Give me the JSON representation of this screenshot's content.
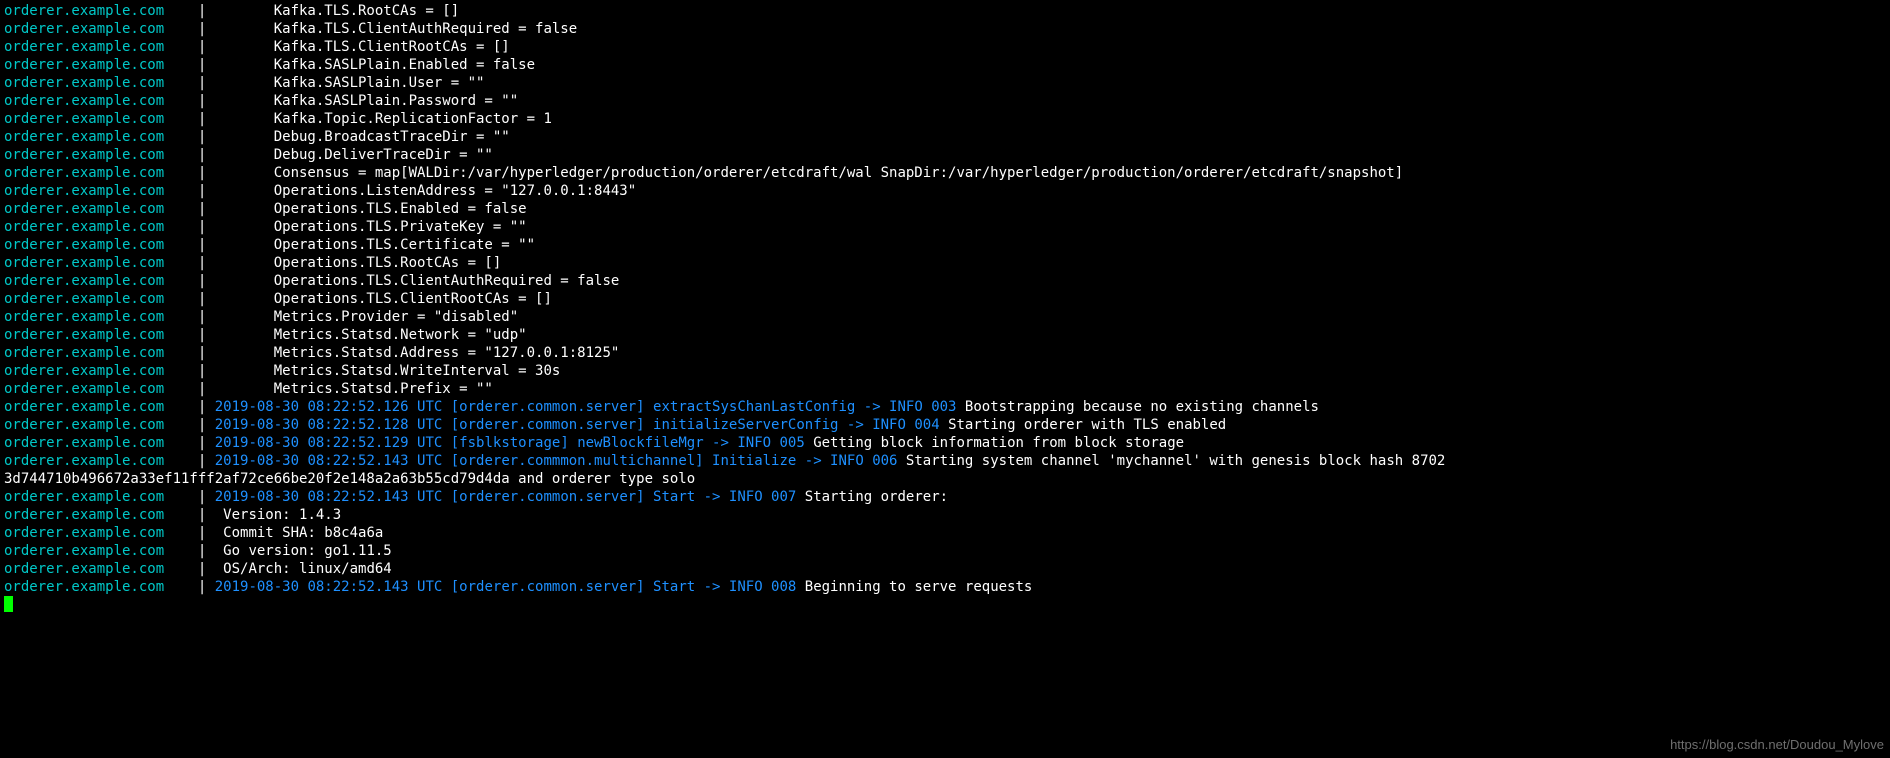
{
  "host": "orderer.example.com",
  "pad": "    ",
  "separator": "|",
  "config_indent": "\t",
  "config_lines": [
    "Kafka.TLS.RootCAs = []",
    "Kafka.TLS.ClientAuthRequired = false",
    "Kafka.TLS.ClientRootCAs = []",
    "Kafka.SASLPlain.Enabled = false",
    "Kafka.SASLPlain.User = \"\"",
    "Kafka.SASLPlain.Password = \"\"",
    "Kafka.Topic.ReplicationFactor = 1",
    "Debug.BroadcastTraceDir = \"\"",
    "Debug.DeliverTraceDir = \"\"",
    "Consensus = map[WALDir:/var/hyperledger/production/orderer/etcdraft/wal SnapDir:/var/hyperledger/production/orderer/etcdraft/snapshot]",
    "Operations.ListenAddress = \"127.0.0.1:8443\"",
    "Operations.TLS.Enabled = false",
    "Operations.TLS.PrivateKey = \"\"",
    "Operations.TLS.Certificate = \"\"",
    "Operations.TLS.RootCAs = []",
    "Operations.TLS.ClientAuthRequired = false",
    "Operations.TLS.ClientRootCAs = []",
    "Metrics.Provider = \"disabled\"",
    "Metrics.Statsd.Network = \"udp\"",
    "Metrics.Statsd.Address = \"127.0.0.1:8125\"",
    "Metrics.Statsd.WriteInterval = 30s",
    "Metrics.Statsd.Prefix = \"\""
  ],
  "log_entries": [
    {
      "ts": "2019-08-30 08:22:52.126 UTC",
      "src": "[orderer.common.server]",
      "fn": "extractSysChanLastConfig -> INFO 003",
      "msg": "Bootstrapping because no existing channels",
      "continuation": null
    },
    {
      "ts": "2019-08-30 08:22:52.128 UTC",
      "src": "[orderer.common.server]",
      "fn": "initializeServerConfig -> INFO 004",
      "msg": "Starting orderer with TLS enabled",
      "continuation": null
    },
    {
      "ts": "2019-08-30 08:22:52.129 UTC",
      "src": "[fsblkstorage]",
      "fn": "newBlockfileMgr -> INFO 005",
      "msg": "Getting block information from block storage",
      "continuation": null
    },
    {
      "ts": "2019-08-30 08:22:52.143 UTC",
      "src": "[orderer.commmon.multichannel]",
      "fn": "Initialize -> INFO 006",
      "msg": "Starting system channel 'mychannel' with genesis block hash 8702",
      "continuation": "3d744710b496672a33ef11fff2af72ce66be20f2e148a2a63b55cd79d4da and orderer type solo"
    },
    {
      "ts": "2019-08-30 08:22:52.143 UTC",
      "src": "[orderer.common.server]",
      "fn": "Start -> INFO 007",
      "msg": "Starting orderer:",
      "continuation": null
    }
  ],
  "start_details": [
    " Version: 1.4.3",
    " Commit SHA: b8c4a6a",
    " Go version: go1.11.5",
    " OS/Arch: linux/amd64"
  ],
  "final_log": {
    "ts": "2019-08-30 08:22:52.143 UTC",
    "src": "[orderer.common.server]",
    "fn": "Start -> INFO 008",
    "msg": "Beginning to serve requests"
  },
  "watermark": "https://blog.csdn.net/Doudou_Mylove"
}
